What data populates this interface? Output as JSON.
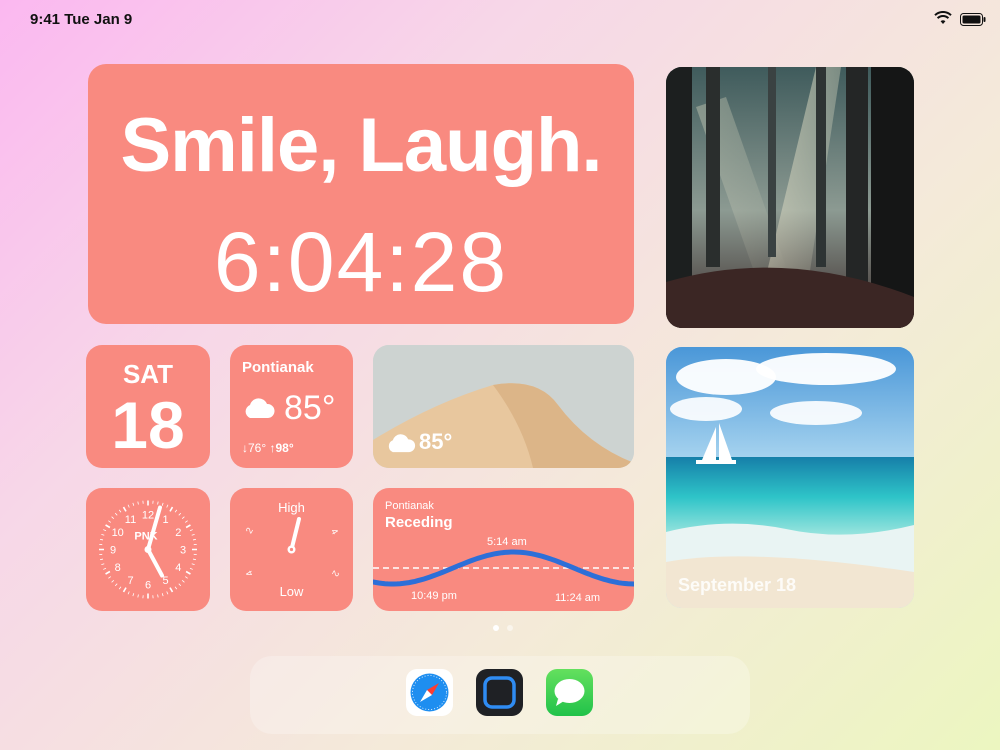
{
  "status": {
    "time": "9:41  Tue Jan 9"
  },
  "big_widget": {
    "quote": "Smile, Laugh.",
    "clock": "6:04:28"
  },
  "calendar": {
    "weekday": "SAT",
    "day": "18"
  },
  "weather": {
    "city": "Pontianak",
    "temp": "85°",
    "low": "76°",
    "high": "98°"
  },
  "sand_weather": {
    "temp": "85°"
  },
  "analog_clock": {
    "label": "PNK",
    "numbers": [
      "12",
      "1",
      "2",
      "3",
      "4",
      "5",
      "6",
      "7",
      "8",
      "9",
      "10",
      "11"
    ]
  },
  "tide_dial": {
    "high_label": "High",
    "low_label": "Low"
  },
  "tide": {
    "city": "Pontianak",
    "state": "Receding",
    "time_top": "5:14 am",
    "time_left": "10:49 pm",
    "time_right": "11:24 am"
  },
  "photo_caption": "September 18",
  "page_dots": 2,
  "dock": {
    "apps": [
      "safari-icon",
      "frame-icon",
      "messages-icon"
    ]
  },
  "colors": {
    "widget": "#f98a80",
    "tide_line": "#2d6fd8"
  }
}
